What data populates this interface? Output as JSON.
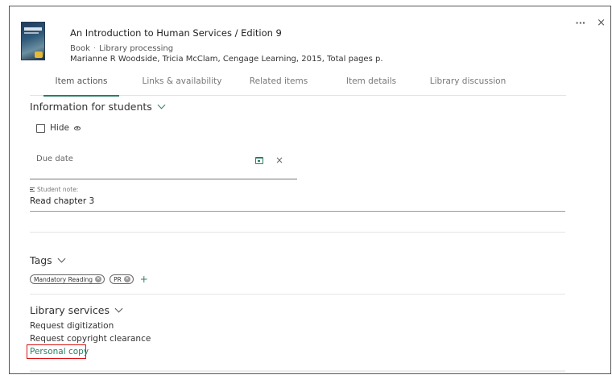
{
  "window": {
    "more_label": "···",
    "close_label": "×"
  },
  "item": {
    "title": "An Introduction to Human Services / Edition 9",
    "type": "Book",
    "status": "Library processing",
    "authors": "Marianne R Woodside, Tricia McClam, Cengage Learning, 2015, Total pages p."
  },
  "tabs": [
    {
      "label": "Item actions",
      "active": true
    },
    {
      "label": "Links & availability"
    },
    {
      "label": "Related items"
    },
    {
      "label": "Item details"
    },
    {
      "label": "Library discussion"
    }
  ],
  "info_students": {
    "title": "Information for students",
    "hide_label": "Hide",
    "due_date_label": "Due date",
    "clear_label": "×",
    "note_label": "Student note:",
    "note_value": "Read chapter 3"
  },
  "tags_section": {
    "title": "Tags",
    "chips": [
      {
        "label": "Mandatory Reading"
      },
      {
        "label": "PR"
      }
    ],
    "add_label": "+"
  },
  "library_services": {
    "title": "Library services",
    "items": [
      {
        "label": "Request digitization"
      },
      {
        "label": "Request copyright clearance"
      },
      {
        "label": "Personal copy"
      }
    ]
  },
  "colors": {
    "accent": "#2a7f62",
    "highlight": "#dd1111"
  },
  "icons": [
    "more-icon",
    "close-icon",
    "eye-icon",
    "calendar-icon",
    "clear-icon",
    "note-icon",
    "chevron-down-icon",
    "chip-remove-icon",
    "add-icon"
  ]
}
